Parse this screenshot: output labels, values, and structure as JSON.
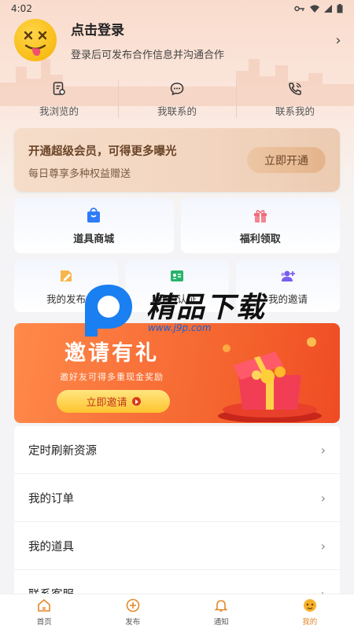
{
  "status_bar": {
    "time": "4:02"
  },
  "profile": {
    "title": "点击登录",
    "subtitle": "登录后可发布合作信息并沟通合作"
  },
  "stats": [
    {
      "label": "我浏览的",
      "icon": "browse-history-icon"
    },
    {
      "label": "我联系的",
      "icon": "chat-icon"
    },
    {
      "label": "联系我的",
      "icon": "phone-icon"
    }
  ],
  "vip": {
    "title": "开通超级会员，可得更多曝光",
    "subtitle": "每日尊享多种权益赠送",
    "button": "立即开通"
  },
  "shortcuts_row1": [
    {
      "label": "道具商城",
      "icon": "shopping-bag-icon"
    },
    {
      "label": "福利领取",
      "icon": "gift-icon"
    }
  ],
  "shortcuts_row2": [
    {
      "label": "我的发布",
      "icon": "edit-icon"
    },
    {
      "label": "我的认证",
      "icon": "id-card-icon"
    },
    {
      "label": "我的邀请",
      "icon": "add-user-icon"
    }
  ],
  "watermark": {
    "title": "精品下载",
    "url": "www.j9p.com"
  },
  "invite": {
    "title": "邀请有礼",
    "subtitle": "邀好友可得多重现金奖励",
    "button": "立即邀请"
  },
  "menu": [
    {
      "label": "定时刷新资源"
    },
    {
      "label": "我的订单"
    },
    {
      "label": "我的道具"
    },
    {
      "label": "联系客服"
    }
  ],
  "tabbar": [
    {
      "label": "首页",
      "icon": "home-icon",
      "active": false
    },
    {
      "label": "发布",
      "icon": "publish-icon",
      "active": false
    },
    {
      "label": "通知",
      "icon": "bell-icon",
      "active": false
    },
    {
      "label": "我的",
      "icon": "profile-icon",
      "active": true
    }
  ],
  "colors": {
    "accent": "#e2892a",
    "vip_text": "#6a4427",
    "invite_bg": "#f4612c"
  }
}
